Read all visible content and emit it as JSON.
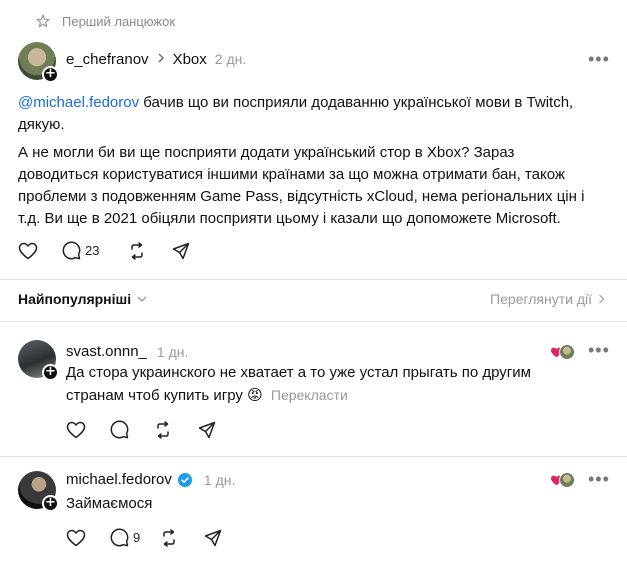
{
  "thread_header": {
    "label": "Перший ланцюжок"
  },
  "main_post": {
    "username": "e_chefranov",
    "community": "Xbox",
    "time": "2 дн.",
    "mention": "@michael.fedorov",
    "paragraph1_rest": " бачив що ви посприяли додаванню української мови в Twitch, дякую.",
    "paragraph2": "А не могли би ви ще посприяти додати український стор в Xbox? Зараз доводиться користуватися іншими країнами за що можна отримати бан, також проблеми з подовженням Game Pass, відсутність xCloud, нема регіональних цін і т.д. Ви ще в 2021 обіцяли посприяти цьому і казали що допоможете Microsoft.",
    "reply_count": "23"
  },
  "sort_bar": {
    "left_label": "Найпопулярніші",
    "right_label": "Переглянути дії"
  },
  "replies": [
    {
      "username": "svast.onnn_",
      "time": "1 дн.",
      "text": "Да стора украинского не хватает а то уже устал прыгать по другим странам чтоб купить игру",
      "emoji": "😡",
      "translate": "Перекласти",
      "reply_count": ""
    },
    {
      "username": "michael.fedorov",
      "time": "1 дн.",
      "text": "Займаємося",
      "reply_count": "9"
    }
  ],
  "colors": {
    "link": "#1a6de0",
    "verified": "#1d9bf0",
    "heart": "#e0245e"
  }
}
